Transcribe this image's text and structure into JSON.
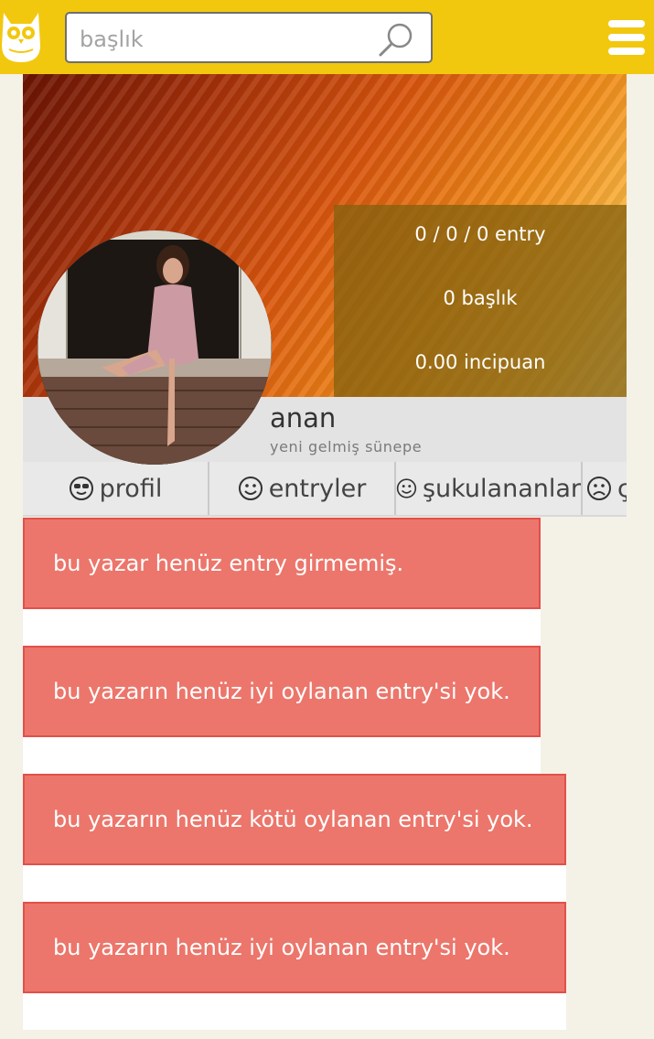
{
  "header": {
    "search_placeholder": "başlık"
  },
  "profile": {
    "stats": {
      "entries": "0 / 0 / 0 entry",
      "topics": "0 başlık",
      "points": "0.00 incipuan"
    },
    "username": "anan",
    "title": "yeni gelmiş sünepe"
  },
  "tabs": [
    {
      "label": "profil",
      "icon": "cool-face-icon"
    },
    {
      "label": "entryler",
      "icon": "smile-icon"
    },
    {
      "label": "şukulananlar",
      "icon": "smile-icon"
    },
    {
      "label": "ç",
      "icon": "sad-face-icon"
    }
  ],
  "messages": [
    "bu yazar henüz entry girmemiş.",
    "bu yazarın henüz iyi oylanan entry'si yok.",
    "bu yazarın henüz kötü oylanan entry'si yok.",
    "bu yazarın henüz iyi oylanan entry'si yok."
  ],
  "colors": {
    "header": "#f2c80f",
    "message_bg": "#ec766b",
    "message_border": "#e2504a"
  }
}
